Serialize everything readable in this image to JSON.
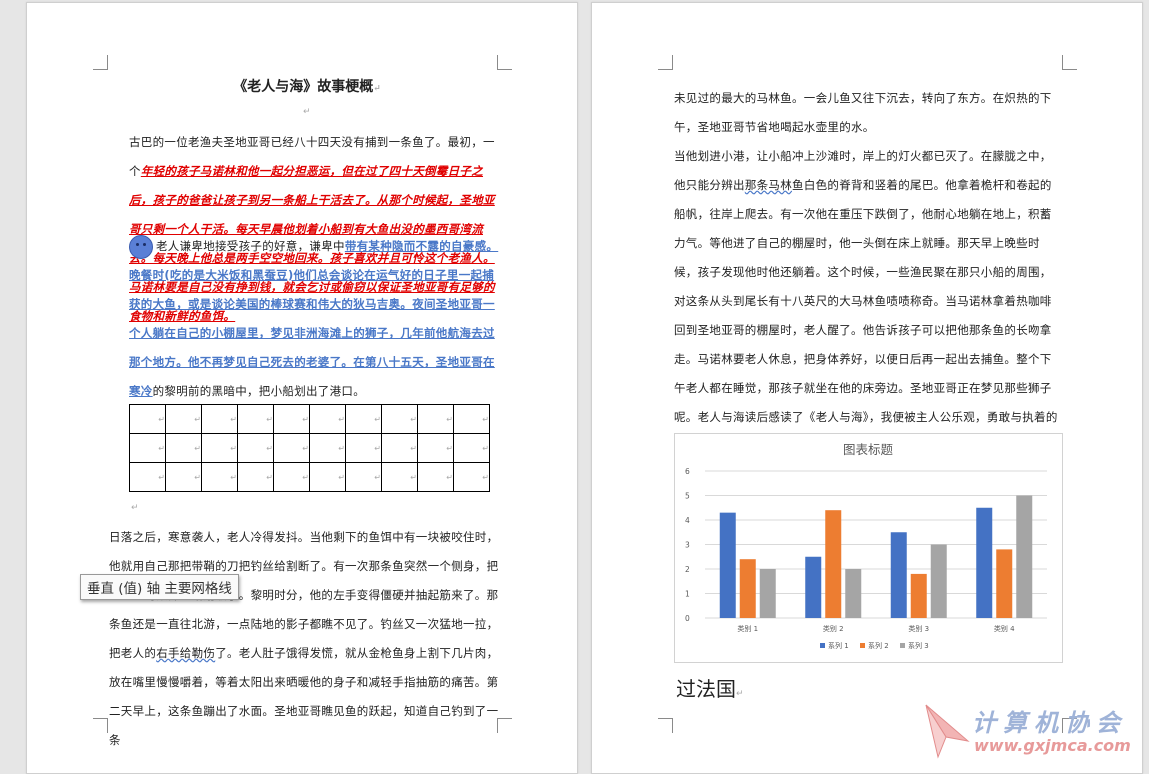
{
  "left_page": {
    "title": "《老人与海》故事梗概",
    "para1": {
      "plain": "古巴的一位老渔夫圣地亚哥已经八十四天没有捕到一条鱼了。最初，一个",
      "red": "年轻的孩子马诺林和他一起分担恶运，但在过了四十天倒霉日子之后，孩子的爸爸让孩子到另一条船上干活去了。从那个时候起，圣地亚哥只剩一个人干活。每天早晨他划着小船到有大鱼出没的墨西哥湾流去。每天晚上他总是两手空空地回来。孩子喜欢并且可怜这个老渔人。马诺林要是自己没有挣到钱，就会乞讨或偷窃以保证圣地亚哥有足够的食物和新鲜的鱼饵。"
    },
    "para2": {
      "plain1": "老人谦卑地接受孩子的好意，谦卑中",
      "blue": "带有某种隐而不露的自豪感。晚餐时(吃的是大米饭和黑蚕豆)他们总会谈论在运气好的日子里一起捕获的大鱼，或是谈论美国的棒球赛和伟大的狄马吉奥。夜间圣地亚哥一个人躺在自己的小棚屋里，梦见非洲海滩上的狮子，几年前他航海去过那个地方。他不再梦见自己死去的老婆了。在第八十五天，圣地亚哥在寒冷",
      "plain2": "的黎明前的黑暗中，把小船划出了港口。"
    },
    "para3": {
      "t1": "日落之后，寒意袭人，老人冷得发抖。当他剩下的鱼饵中有一块被咬住时，他就用自己那把带鞘的刀把钓丝给割断了。有一次那条鱼突然一个侧身，把圣地亚哥",
      "t2": "颊部也给划破了。黎明时分，他的左手变得僵硬并抽起筋来了。那条鱼还是一直往北游，一点陆地的影子都瞧不见了。钓丝又一次猛地一拉，把老人的",
      "squiggle": "右手给勒伤",
      "t3": "了。老人肚子饿得发慌，就从金枪鱼身上割下几片肉，放在嘴里慢慢嚼着，等着太阳出来晒暖他的身子和减轻手指抽筋的痛苦。第二天早上，这条鱼蹦出了水面。圣地亚哥瞧见鱼的跃起，知道自己钓到了一条"
    },
    "tooltip": "垂直 (值) 轴 主要网格线"
  },
  "right_page": {
    "para1": "未见过的最大的马林鱼。一会儿鱼又往下沉去，转向了东方。在炽热的下午，圣地亚哥节省地喝起水壶里的水。",
    "para2": {
      "t1": "当他划进小港，让小船冲上沙滩时，岸上的灯火都已灭了。在朦胧之中，他只能分辨出",
      "squiggle": "那条马林",
      "t2": "鱼白色的脊背和竖着的尾巴。他拿着桅杆和卷起的船帆，往岸上爬去。有一次他在重压下跌倒了，他耐心地躺在地上，积蓄力气。等他进了自己的棚屋时，他一头倒在床上就睡。那天早上晚些时候，孩子发现他时他还躺着。这个时候，一些渔民聚在那只小船的周围，对这条从头到尾长有十八英尺的大马林鱼啧啧称奇。当马诺林拿着热咖啡回到圣地亚哥的棚屋时，老人醒了。他告诉孩子可以把他那条鱼的长吻拿走。马诺林要老人休息，把身体养好，以便日后再一起出去捕鱼。整个下午老人都在睡觉，那孩子就坐在他的床旁边。圣地亚哥正在梦见那些狮子呢。老人与海读后感读了《老人与海》，我便被主人公乐观，勇敢与执着的硬汉形象所深深吸引。"
    },
    "heading": "过法国"
  },
  "chart_data": {
    "type": "bar",
    "title": "图表标题",
    "categories": [
      "类别 1",
      "类别 2",
      "类别 3",
      "类别 4"
    ],
    "series": [
      {
        "name": "系列 1",
        "values": [
          4.3,
          2.5,
          3.5,
          4.5
        ],
        "color": "#4472c4"
      },
      {
        "name": "系列 2",
        "values": [
          2.4,
          4.4,
          1.8,
          2.8
        ],
        "color": "#ed7d31"
      },
      {
        "name": "系列 3",
        "values": [
          2,
          2,
          3,
          5
        ],
        "color": "#a5a5a5"
      }
    ],
    "ylim": [
      0,
      6
    ],
    "yticks": [
      "0",
      "1",
      "2",
      "3",
      "4",
      "5",
      "6"
    ],
    "grid": true,
    "legend": "bottom"
  },
  "watermark": {
    "title": "计算机协会",
    "url": "www.gxjmca.com"
  }
}
